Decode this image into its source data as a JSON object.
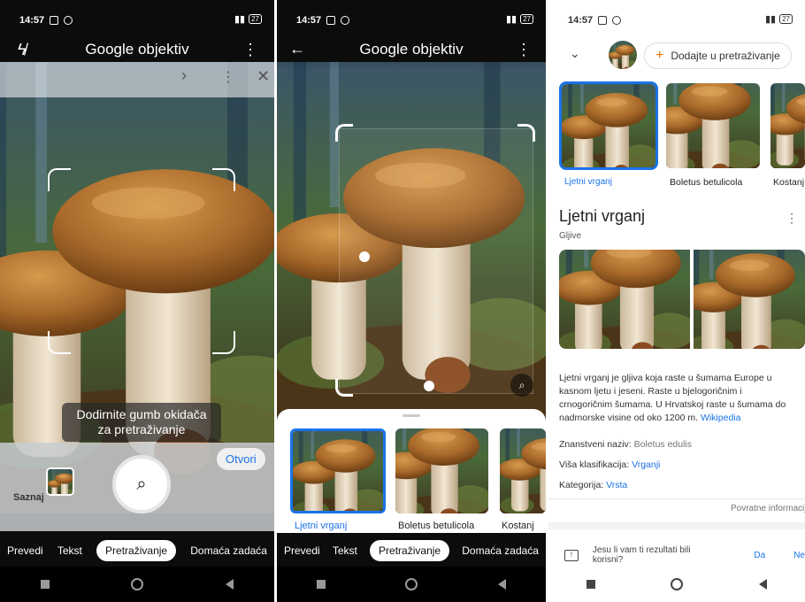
{
  "status": {
    "time": "14:57",
    "battery": "27"
  },
  "screen1": {
    "title": "Google objektiv",
    "hint_line1": "Dodirnite gumb okidača",
    "hint_line2": "za pretraživanje",
    "open_button": "Otvori",
    "learn_label": "Saznaj",
    "modes": [
      "Prevedi",
      "Tekst",
      "Pretraživanje",
      "Domaća zadaća"
    ]
  },
  "screen2": {
    "title": "Google objektiv",
    "results": [
      "Ljetni vrganj",
      "Boletus betulicola",
      "Kostanj"
    ],
    "modes": [
      "Prevedi",
      "Tekst",
      "Pretraživanje",
      "Domaća zadaća"
    ]
  },
  "screen3": {
    "add_search": "Dodajte u pretraživanje",
    "results": [
      "Ljetni vrganj",
      "Boletus betulicola",
      "Kostanj"
    ],
    "heading": "Ljetni vrganj",
    "subheading": "Gljive",
    "description": "Ljetni vrganj je gljiva koja raste u šumama Europe u kasnom ljetu i jeseni. Raste u bjelogoričnim i crnogoričnim šumama. U Hrvatskoj raste u šumama do nadmorske visine od oko 1200 m.",
    "source_link": "Wikipedia",
    "sci_label": "Znanstveni naziv:",
    "sci_value": "Boletus edulis",
    "class_label": "Viša klasifikacija:",
    "class_value": "Vrganji",
    "cat_label": "Kategorija:",
    "cat_value": "Vrsta",
    "feedback": "Povratne informacije",
    "question": "Jesu li vam ti rezultati bili korisni?",
    "yes": "Da",
    "no": "Ne"
  },
  "colors": {
    "accent": "#1a73e8",
    "cap": "#a8692a",
    "stem": "#e9dcc4",
    "moss": "#3d5a1e"
  }
}
